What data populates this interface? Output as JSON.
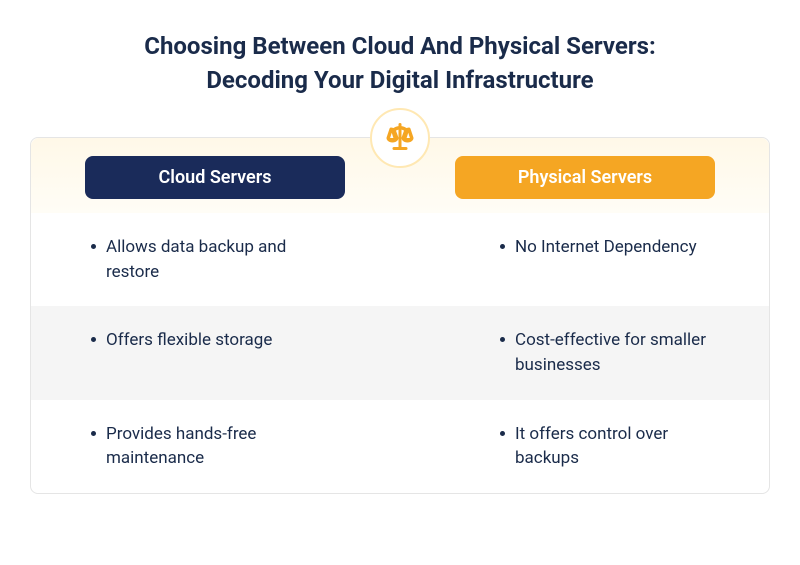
{
  "title_line1": "Choosing Between Cloud And Physical Servers:",
  "title_line2": "Decoding Your Digital Infrastructure",
  "columns": {
    "left": {
      "heading": "Cloud Servers",
      "items": [
        "Allows data backup and restore",
        "Offers flexible storage",
        "Provides hands-free maintenance"
      ]
    },
    "right": {
      "heading": "Physical Servers",
      "items": [
        "No Internet Dependency",
        "Cost-effective for smaller businesses",
        "It offers control over backups"
      ]
    }
  },
  "colors": {
    "navy": "#1a2b5a",
    "orange": "#f5a623",
    "cream": "#fff8e8"
  }
}
